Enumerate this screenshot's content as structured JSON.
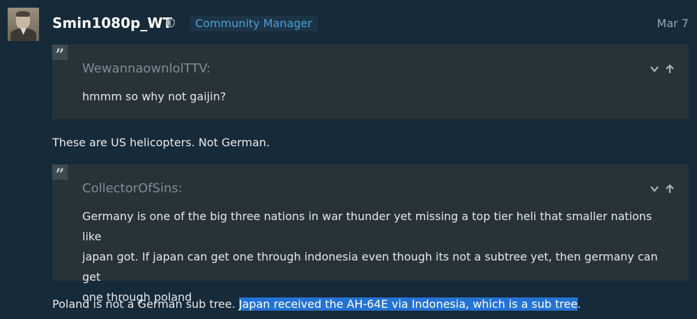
{
  "post": {
    "username": "Smin1080p_WT",
    "user_title": "Community Manager",
    "date": "Mar 7"
  },
  "quotes": [
    {
      "author": "WewannaownlolTTV:",
      "text": "hmmm so why not gaijin?"
    },
    {
      "author": "CollectorOfSins:",
      "lines": [
        "Germany is one of the big three nations in war thunder yet missing a top tier heli that smaller nations like",
        "japan got. If japan can get one through indonesia even though its not a subtree yet, then germany can get",
        "one through poland"
      ]
    }
  ],
  "replies": {
    "first": "These are US helicopters. Not German.",
    "second_plain": "Poland is not a German sub tree. ",
    "second_selected": "Japan received the AH-64E via Indonesia, which is a sub tree",
    "second_end": "."
  },
  "icons": {
    "quote": "quote-icon",
    "expand": "chevron-down-icon",
    "goto": "arrow-up-icon",
    "shield": "moderator-shield-icon"
  },
  "colors": {
    "background": "#172a39",
    "quote_bg": "#283339",
    "accent": "#47a0d8",
    "selection": "#2473d4"
  }
}
